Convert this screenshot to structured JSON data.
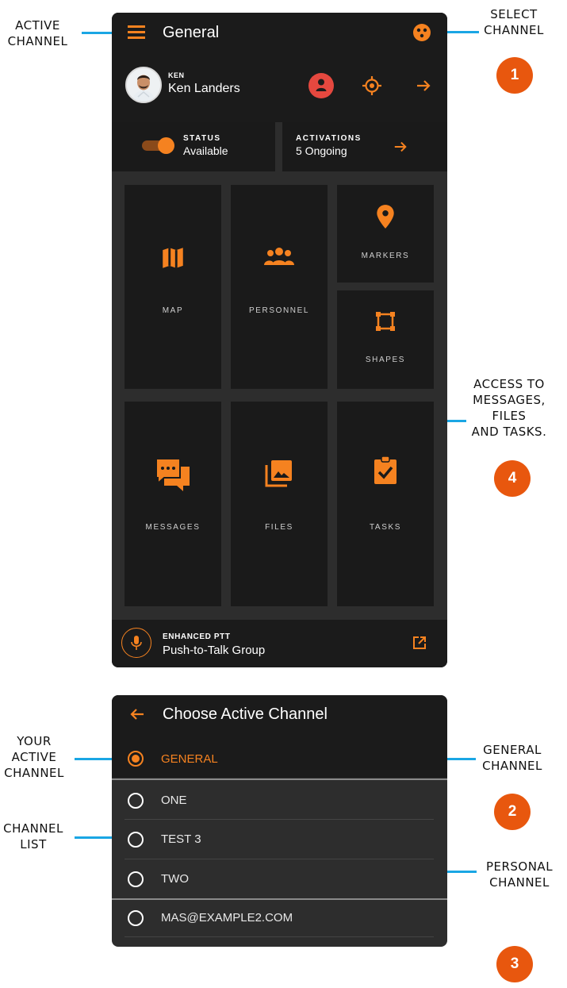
{
  "annotations": {
    "active_channel": [
      "ACTIVE",
      "CHANNEL"
    ],
    "select_channel": [
      "SELECT",
      "CHANNEL"
    ],
    "access": [
      "ACCESS TO",
      "MESSAGES,",
      "FILES",
      "AND TASKS."
    ],
    "your_active": [
      "YOUR",
      "ACTIVE",
      "CHANNEL"
    ],
    "channel_list": [
      "CHANNEL",
      "LIST"
    ],
    "general_channel": [
      "GENERAL",
      "CHANNEL"
    ],
    "personal_channel": [
      "PERSONAL",
      "CHANNEL"
    ],
    "badges": [
      "1",
      "2",
      "3",
      "4"
    ]
  },
  "home": {
    "title": "General",
    "user": {
      "short": "KEN",
      "name": "Ken Landers"
    },
    "status": {
      "label": "STATUS",
      "value": "Available"
    },
    "activations": {
      "label": "ACTIVATIONS",
      "value": "5 Ongoing"
    },
    "tiles": {
      "map": "MAP",
      "personnel": "PERSONNEL",
      "markers": "MARKERS",
      "shapes": "SHAPES",
      "messages": "MESSAGES",
      "files": "FILES",
      "tasks": "TASKS"
    },
    "ptt": {
      "label": "ENHANCED PTT",
      "value": "Push-to-Talk Group"
    }
  },
  "chooser": {
    "title": "Choose Active Channel",
    "channels": [
      "GENERAL",
      "ONE",
      "TEST 3",
      "TWO",
      "MAS@EXAMPLE2.COM"
    ],
    "selected": "GENERAL"
  },
  "colors": {
    "accent": "#f58220",
    "callout": "#1aa6e4",
    "badge": "#e8570e"
  }
}
